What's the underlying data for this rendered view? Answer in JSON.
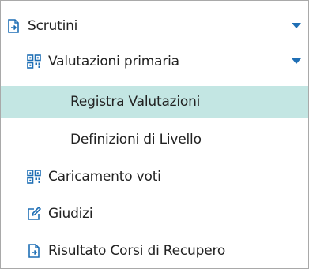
{
  "menu": {
    "scrutini": {
      "label": "Scrutini",
      "icon": "export-document-icon"
    },
    "valutazioni_primaria": {
      "label": "Valutazioni primaria",
      "icon": "qr-grid-icon"
    },
    "registra_valutazioni": {
      "label": "Registra Valutazioni"
    },
    "definizioni_livello": {
      "label": "Definizioni di Livello"
    },
    "caricamento_voti": {
      "label": "Caricamento voti",
      "icon": "qr-grid-icon"
    },
    "giudizi": {
      "label": "Giudizi",
      "icon": "edit-pencil-icon"
    },
    "risultato_corsi": {
      "label": "Risultato Corsi di Recupero",
      "icon": "export-document-icon"
    }
  },
  "colors": {
    "active_background": "#c3e6e3",
    "caret": "#1f6fb5",
    "icon": "#1f6fb5",
    "text": "#222222"
  }
}
